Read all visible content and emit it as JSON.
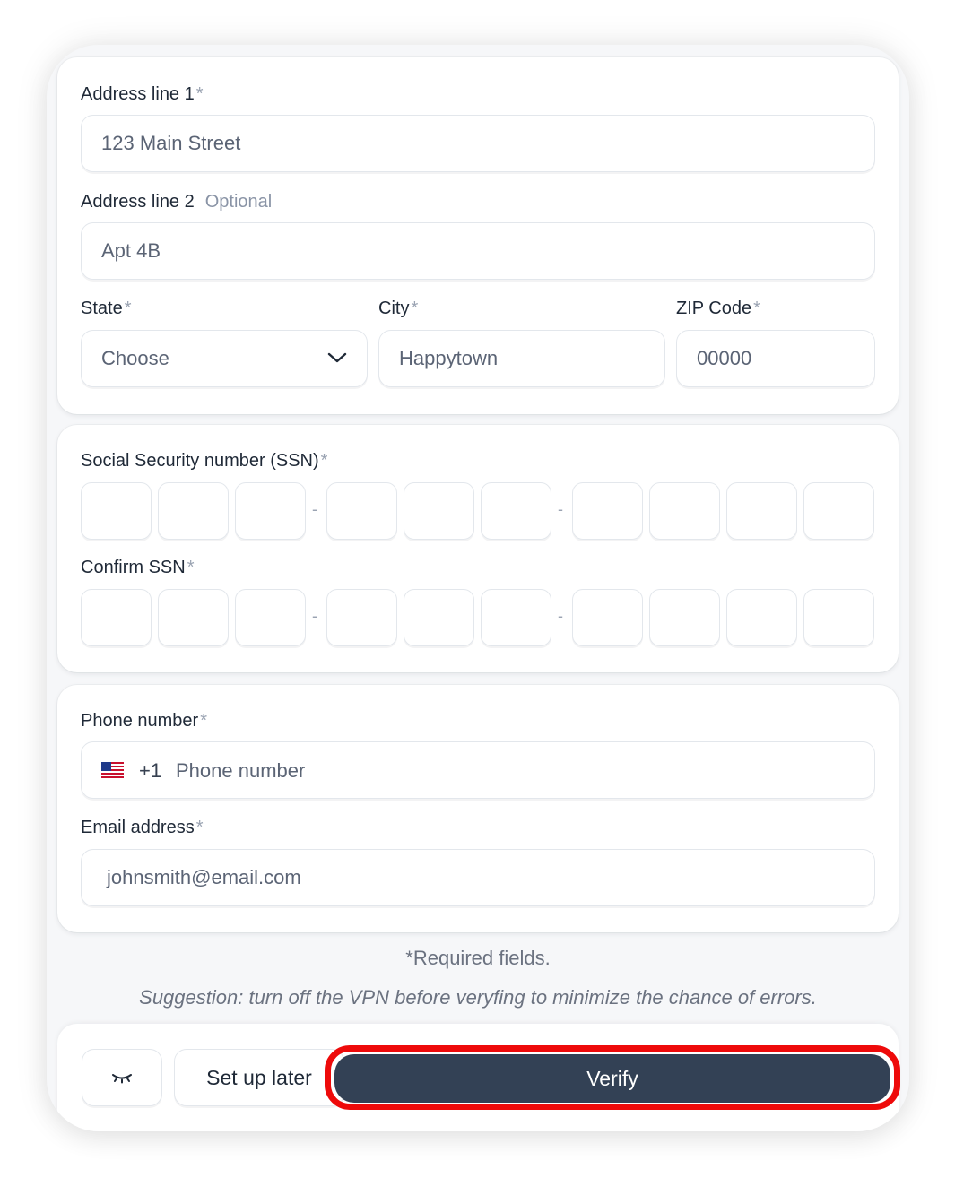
{
  "address": {
    "line1_label": "Address line 1",
    "line1_value": "123 Main Street",
    "line2_label": "Address line 2",
    "line2_optional": "Optional",
    "line2_value": "Apt 4B",
    "state_label": "State",
    "state_value": "Choose",
    "city_label": "City",
    "city_value": "Happytown",
    "zip_label": "ZIP Code",
    "zip_value": "00000"
  },
  "required_mark": "*",
  "ssn": {
    "label": "Social Security number (SSN)",
    "confirm_label": "Confirm SSN",
    "separator": "-"
  },
  "contact": {
    "phone_label": "Phone number",
    "country_code": "+1",
    "phone_placeholder": "Phone number",
    "email_label": "Email address",
    "email_value": "johnsmith@email.com"
  },
  "notes": {
    "required": "*Required fields.",
    "suggestion": "Suggestion: turn off the VPN before veryfing to minimize the chance of errors."
  },
  "actions": {
    "set_up_later": "Set up later",
    "verify": "Verify"
  },
  "icons": {
    "state_dropdown": "chevron-down-icon",
    "country_flag": "us-flag-icon",
    "visibility": "eye-closed-icon"
  },
  "colors": {
    "primary_button": "#334155",
    "highlight_ring": "#ee0a0a",
    "required_asterisk": "#9aa3b2"
  }
}
